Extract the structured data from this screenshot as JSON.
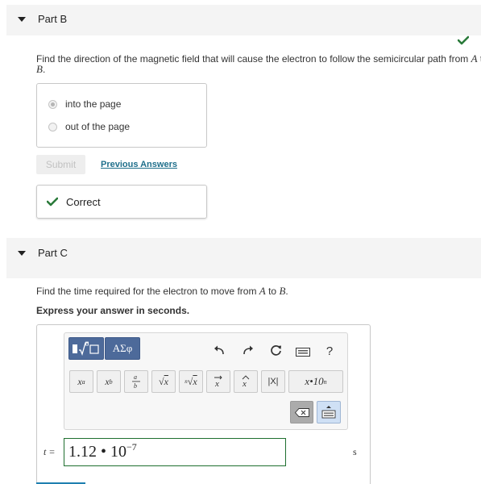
{
  "partB": {
    "title": "Part B",
    "question_pre": "Find the direction of the magnetic field that will cause the electron to follow the semicircular path from ",
    "point_a": "A",
    "question_mid": " to",
    "point_b": "B",
    "question_end": ".",
    "options": [
      {
        "label": "into the page",
        "selected": true
      },
      {
        "label": "out of the page",
        "selected": false
      }
    ],
    "submit_label": "Submit",
    "previous_answers_label": "Previous Answers",
    "feedback_label": "Correct"
  },
  "partC": {
    "title": "Part C",
    "question_pre": "Find the time required for the electron to move from ",
    "point_a": "A",
    "question_mid": " to ",
    "point_b": "B",
    "question_end": ".",
    "instruction": "Express your answer in seconds.",
    "toolbar": {
      "greek_label": "ΑΣφ",
      "help_label": "?",
      "abs_label": "|X|",
      "sci_label": "x•10"
    },
    "variable_label": "t =",
    "answer_mantissa": "1.12 • 10",
    "answer_exponent": "−7",
    "unit_label": "s"
  },
  "colors": {
    "check": "#2a7a3a",
    "header_bg": "#f4f4f4",
    "link": "#1f6f8b",
    "toolbar_accent": "#4d6a9a"
  }
}
